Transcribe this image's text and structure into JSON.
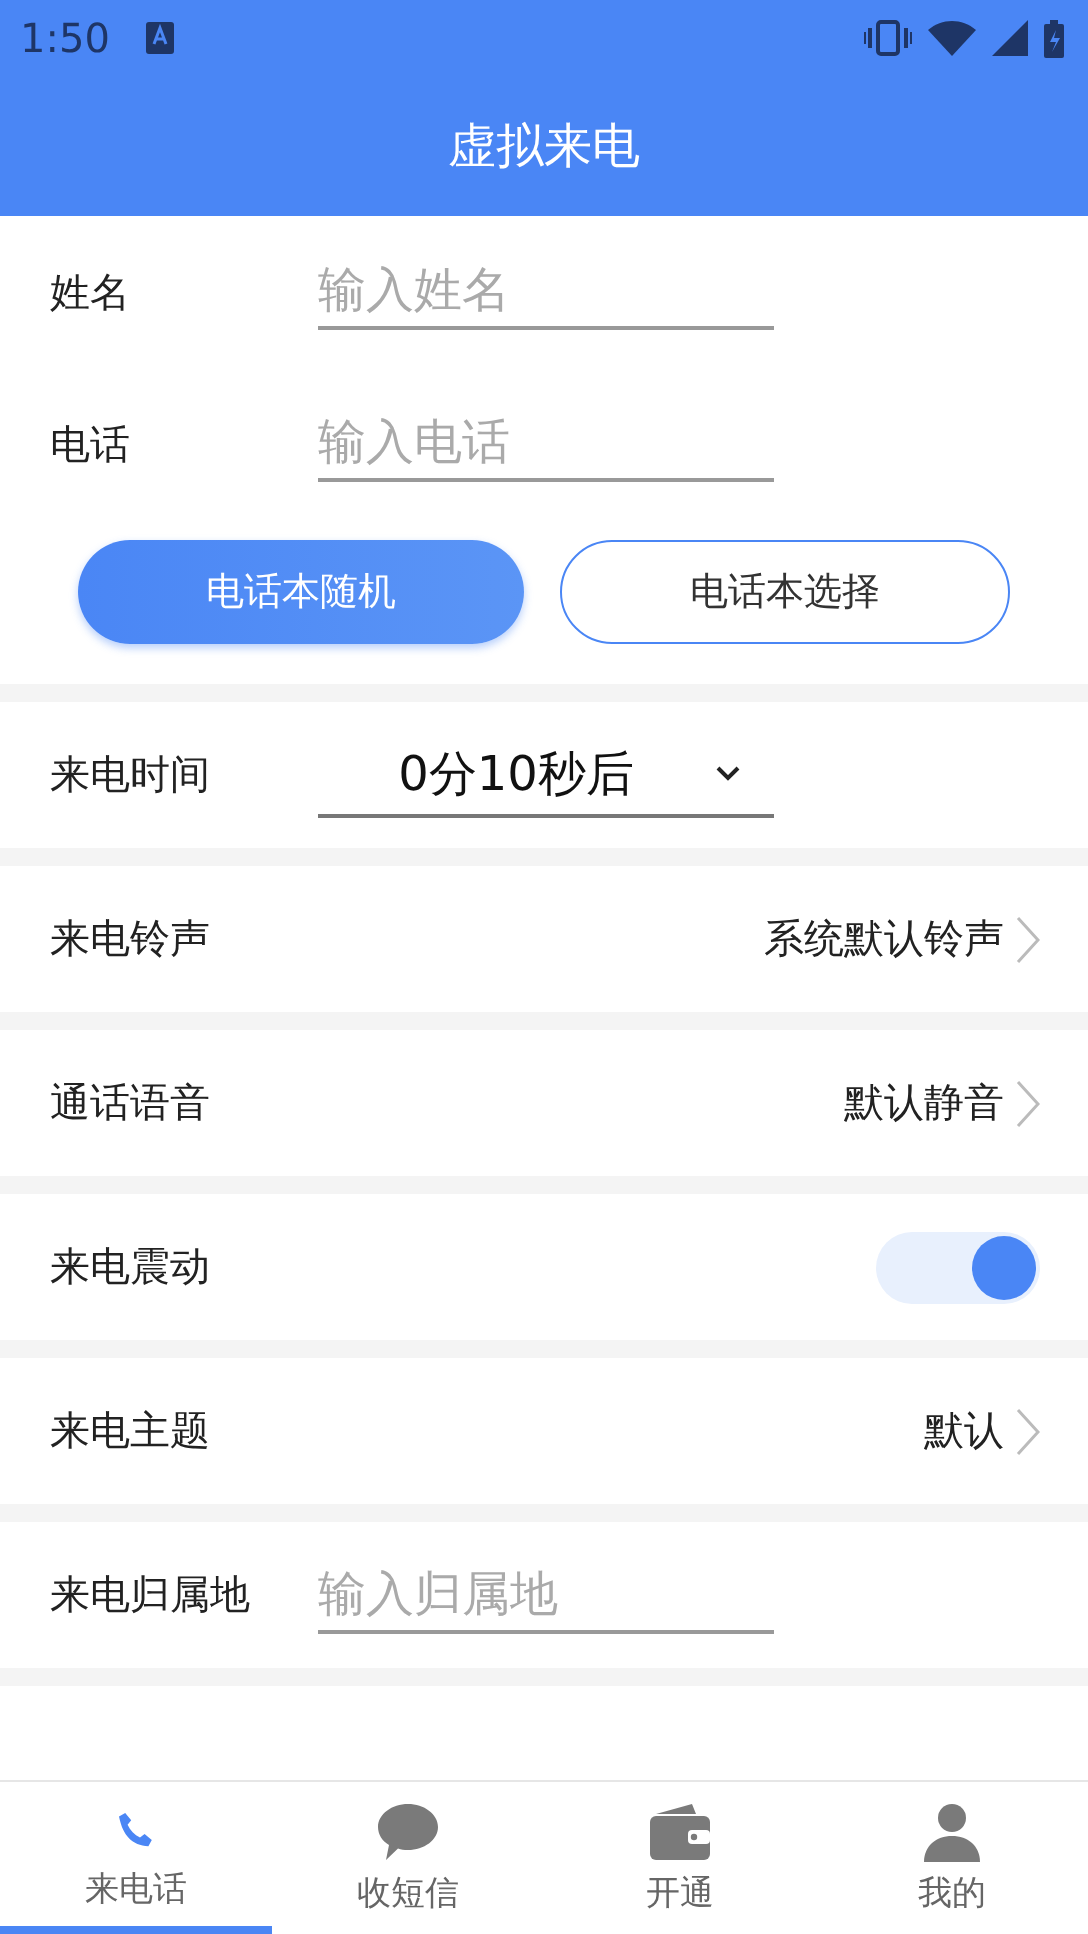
{
  "status_bar": {
    "time": "1:50"
  },
  "header": {
    "title": "虚拟来电"
  },
  "fields": [
    {
      "label": "姓名",
      "placeholder": "输入姓名"
    },
    {
      "label": "电话",
      "placeholder": "输入电话"
    }
  ],
  "buttons": [
    {
      "label": "电话本随机",
      "selected": true
    },
    {
      "label": "电话本选择",
      "selected": false
    }
  ],
  "settings": [
    {
      "kind": "select",
      "label": "来电时间",
      "value": "0分10秒后"
    },
    {
      "kind": "link",
      "label": "来电铃声",
      "value": "系统默认铃声"
    },
    {
      "kind": "link",
      "label": "通话语音",
      "value": "默认静音"
    },
    {
      "kind": "toggle",
      "label": "来电震动",
      "on": true
    },
    {
      "kind": "link",
      "label": "来电主题",
      "value": "默认"
    },
    {
      "kind": "input",
      "label": "来电归属地",
      "placeholder": "输入归属地"
    }
  ],
  "nav": [
    {
      "label": "来电话",
      "selected": true
    },
    {
      "label": "收短信",
      "selected": false
    },
    {
      "label": "开通",
      "selected": false
    },
    {
      "label": "我的",
      "selected": false
    }
  ]
}
